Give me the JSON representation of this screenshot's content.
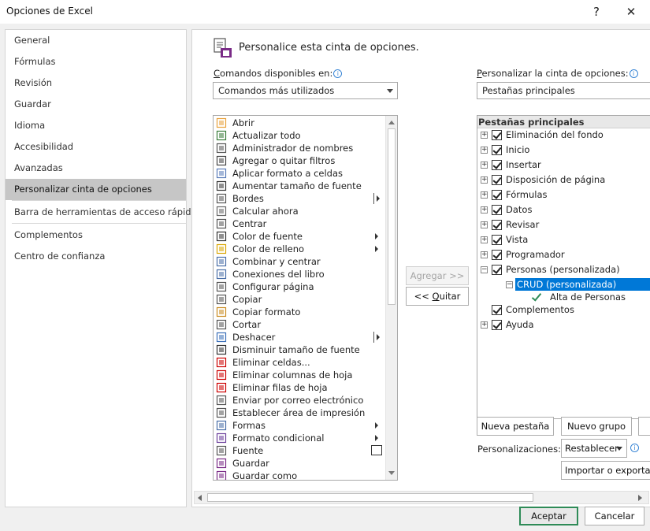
{
  "window": {
    "title": "Opciones de Excel",
    "help": "?",
    "close": "✕"
  },
  "nav": {
    "items": [
      "General",
      "Fórmulas",
      "Revisión",
      "Guardar",
      "Idioma",
      "Accesibilidad",
      "Avanzadas",
      "Personalizar cinta de opciones",
      "Barra de herramientas de acceso rápido",
      "Complementos",
      "Centro de confianza"
    ],
    "active_index": 7
  },
  "header": {
    "title": "Personalice esta cinta de opciones."
  },
  "left": {
    "label_first": "C",
    "label_rest": "omandos disponibles en:",
    "select_value": "Comandos más utilizados",
    "commands": [
      "Abrir",
      "Actualizar todo",
      "Administrador de nombres",
      "Agregar o quitar filtros",
      "Aplicar formato a celdas",
      "Aumentar tamaño de fuente",
      "Bordes",
      "Calcular ahora",
      "Centrar",
      "Color de fuente",
      "Color de relleno",
      "Combinar y centrar",
      "Conexiones del libro",
      "Configurar página",
      "Copiar",
      "Copiar formato",
      "Cortar",
      "Deshacer",
      "Disminuir tamaño de fuente",
      "Eliminar celdas...",
      "Eliminar columnas de hoja",
      "Eliminar filas de hoja",
      "Enviar por correo electrónico",
      "Establecer área de impresión",
      "Formas",
      "Formato condicional",
      "Fuente",
      "Guardar",
      "Guardar como"
    ]
  },
  "middle": {
    "add_label": "Agregar >>",
    "remove_prefix": "<< ",
    "remove_underlined": "Q",
    "remove_rest": "uitar"
  },
  "right": {
    "label_first": "P",
    "label_rest": "ersonalizar la cinta de opciones:",
    "select_value": "Pestañas principales",
    "tree_header": "Pestañas principales",
    "tabs": [
      "Eliminación del fondo",
      "Inicio",
      "Insertar",
      "Disposición de página",
      "Fórmulas",
      "Datos",
      "Revisar",
      "Vista",
      "Programador",
      "Personas (personalizada)"
    ],
    "group": "CRUD (personalizada)",
    "group_item": "Alta de Personas",
    "after": [
      "Complementos",
      "Ayuda"
    ],
    "new_tab_label": "Nueva pestaña",
    "new_group_label": "Nuevo grupo",
    "customizations_label": "Personalizaciones:",
    "reset_label": "Restablecer",
    "import_export_label": "Importar o exportar"
  },
  "footer": {
    "accept": "Aceptar",
    "cancel": "Cancelar"
  }
}
